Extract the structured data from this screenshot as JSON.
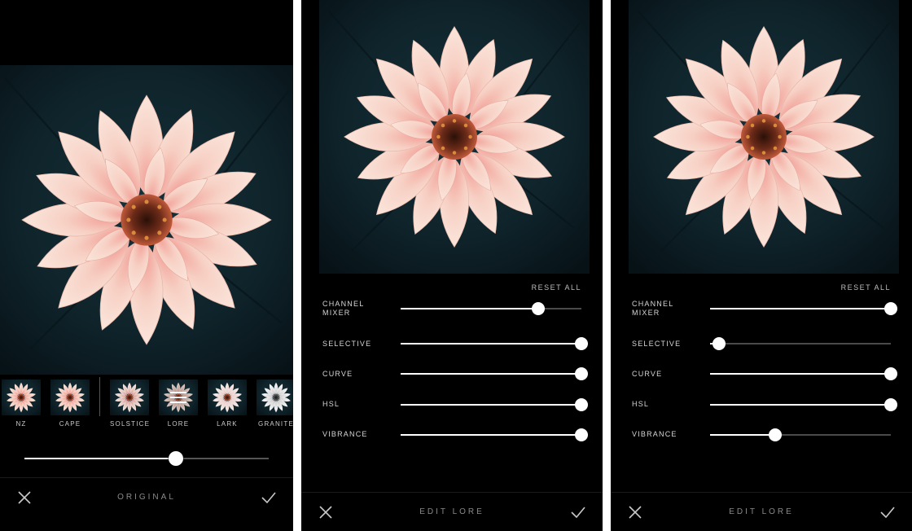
{
  "panelA": {
    "footer_title": "ORIGINAL",
    "intensity_percent": 62,
    "thumbs": [
      {
        "id": "nz",
        "label": "NZ",
        "purple_bar": false,
        "variant": "warm"
      },
      {
        "id": "cape",
        "label": "CAPE",
        "purple_bar": false,
        "variant": "warm"
      },
      {
        "id": "solstice",
        "label": "SOLSTICE",
        "purple_bar": true,
        "variant": "cool"
      },
      {
        "id": "lore",
        "label": "LORE",
        "purple_bar": true,
        "variant": "muted",
        "adjust_icon": true
      },
      {
        "id": "lark",
        "label": "LARK",
        "purple_bar": true,
        "variant": "pale"
      },
      {
        "id": "granite",
        "label": "GRANITE",
        "purple_bar": true,
        "variant": "bw"
      }
    ]
  },
  "panelB": {
    "reset_label": "RESET ALL",
    "footer_title": "EDIT LORE",
    "sliders": [
      {
        "id": "channel_mixer",
        "label": "CHANNEL MIXER",
        "percent": 76
      },
      {
        "id": "selective",
        "label": "SELECTIVE",
        "percent": 100
      },
      {
        "id": "curve",
        "label": "CURVE",
        "percent": 100
      },
      {
        "id": "hsl",
        "label": "HSL",
        "percent": 100
      },
      {
        "id": "vibrance",
        "label": "VIBRANCE",
        "percent": 100
      }
    ]
  },
  "panelC": {
    "reset_label": "RESET ALL",
    "footer_title": "EDIT LORE",
    "sliders": [
      {
        "id": "channel_mixer",
        "label": "CHANNEL MIXER",
        "percent": 100
      },
      {
        "id": "selective",
        "label": "SELECTIVE",
        "percent": 5
      },
      {
        "id": "curve",
        "label": "CURVE",
        "percent": 100
      },
      {
        "id": "hsl",
        "label": "HSL",
        "percent": 100
      },
      {
        "id": "vibrance",
        "label": "VIBRANCE",
        "percent": 36
      }
    ]
  }
}
